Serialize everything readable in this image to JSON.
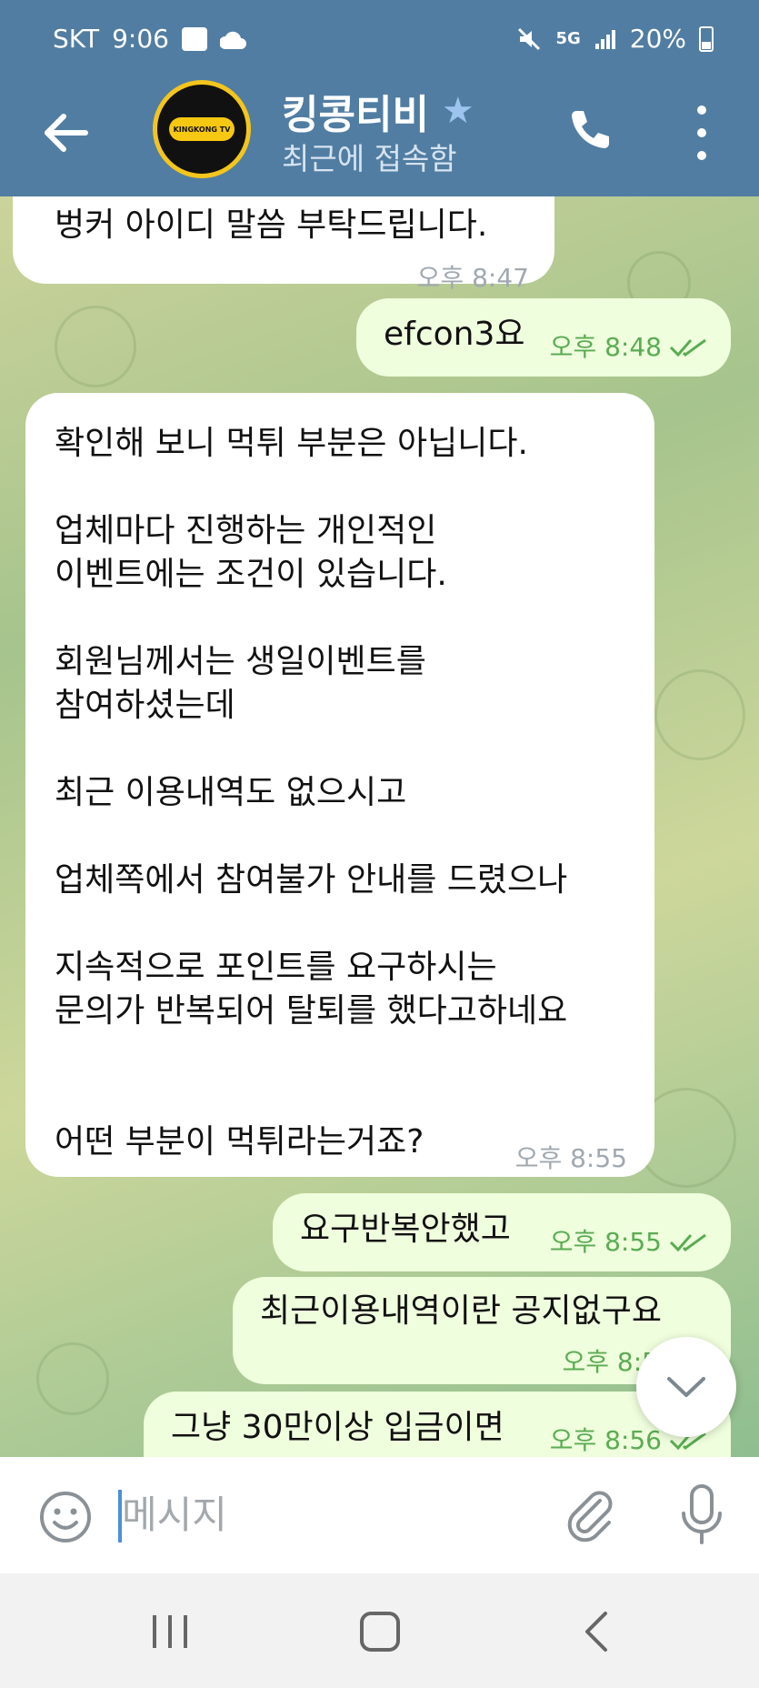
{
  "status_bar": {
    "carrier": "SKT",
    "time": "9:06",
    "network": "5G",
    "battery": "20%"
  },
  "header": {
    "chat_title": "킹콩티비",
    "last_seen": "최근에 접속함",
    "avatar_text": "KINGKONG TV"
  },
  "messages": [
    {
      "direction": "in",
      "text": "벙커 아이디 말씀 부탁드립니다.",
      "time": "오후 8:47"
    },
    {
      "direction": "out",
      "text": "efcon3요",
      "time": "오후 8:48",
      "read": true
    },
    {
      "direction": "in",
      "text": "확인해 보니 먹튀 부분은 아닙니다.\n\n업체마다 진행하는 개인적인\n이벤트에는 조건이 있습니다.\n\n회원님께서는 생일이벤트를\n참여하셨는데\n\n최근 이용내역도 없으시고\n\n업체쪽에서 참여불가 안내를 드렸으나\n\n지속적으로 포인트를 요구하시는\n문의가 반복되어 탈퇴를 했다고하네요\n\n\n어떤 부분이 먹튀라는거죠?",
      "time": "오후 8:55"
    },
    {
      "direction": "out",
      "text": "요구반복안했고",
      "time": "오후 8:55",
      "read": true
    },
    {
      "direction": "out",
      "text": "최근이용내역이란 공지없구요",
      "time": "오후 8:5",
      "read": true
    },
    {
      "direction": "out",
      "text": "그냥 30만이상 입금이면",
      "time": "오후 8:56",
      "read": true
    }
  ],
  "composer": {
    "placeholder": "메시지"
  },
  "colors": {
    "header_bg": "#517da2",
    "incoming_bubble": "#ffffff",
    "outgoing_bubble": "#effedd",
    "outgoing_meta": "#5aac52"
  },
  "icons": [
    "back-arrow-icon",
    "star-icon",
    "phone-icon",
    "more-vert-icon",
    "emoji-icon",
    "paperclip-icon",
    "microphone-icon",
    "chevron-down-icon",
    "double-check-icon"
  ]
}
